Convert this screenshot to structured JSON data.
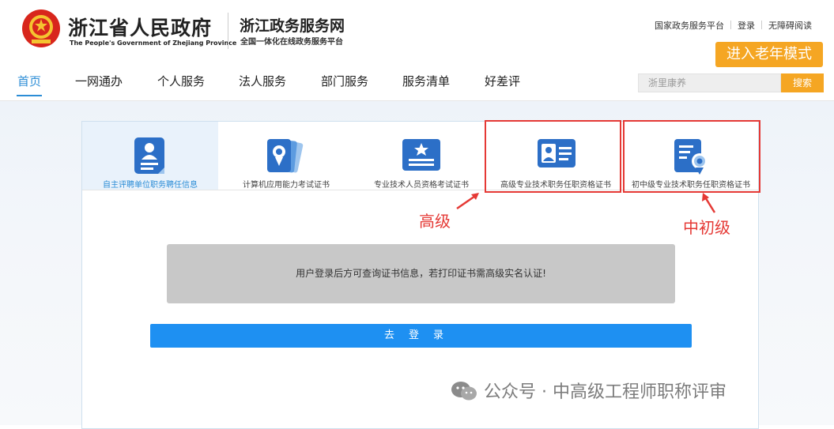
{
  "header": {
    "gov_title": "浙江省人民政府",
    "gov_title_en": "The People's Government of Zhejiang Province",
    "portal_title": "浙江政务服务网",
    "portal_subtitle": "全国一体化在线政务服务平台",
    "top_links": [
      "国家政务服务平台",
      "登录",
      "无障碍阅读"
    ],
    "elder_mode_label": "进入老年模式"
  },
  "nav": {
    "items": [
      "首页",
      "一网通办",
      "个人服务",
      "法人服务",
      "部门服务",
      "服务清单",
      "好差评"
    ],
    "active": "首页"
  },
  "search": {
    "placeholder": "浙里康养",
    "button_label": "搜索"
  },
  "tabs": [
    {
      "label": "自主评聘单位职务聘任信息",
      "icon": "person-document-icon",
      "active": true
    },
    {
      "label": "计算机应用能力考试证书",
      "icon": "award-cards-icon",
      "active": false
    },
    {
      "label": "专业技术人员资格考试证书",
      "icon": "star-certificate-icon",
      "active": false
    },
    {
      "label": "高级专业技术职务任职资格证书",
      "icon": "id-card-icon",
      "active": false
    },
    {
      "label": "初中级专业技术职务任职资格证书",
      "icon": "certificate-medal-icon",
      "active": false
    }
  ],
  "annotations": {
    "senior": "高级",
    "junior": "中初级"
  },
  "notice": "用户登录后方可查询证书信息，若打印证书需高级实名认证!",
  "login_button": "去登录",
  "watermark": {
    "prefix": "公众号 ·",
    "name": "中高级工程师职称评审"
  },
  "colors": {
    "accent": "#2c8dd6",
    "orange": "#f5a623",
    "button_blue": "#1e90f2",
    "annotation_red": "#e53935"
  }
}
